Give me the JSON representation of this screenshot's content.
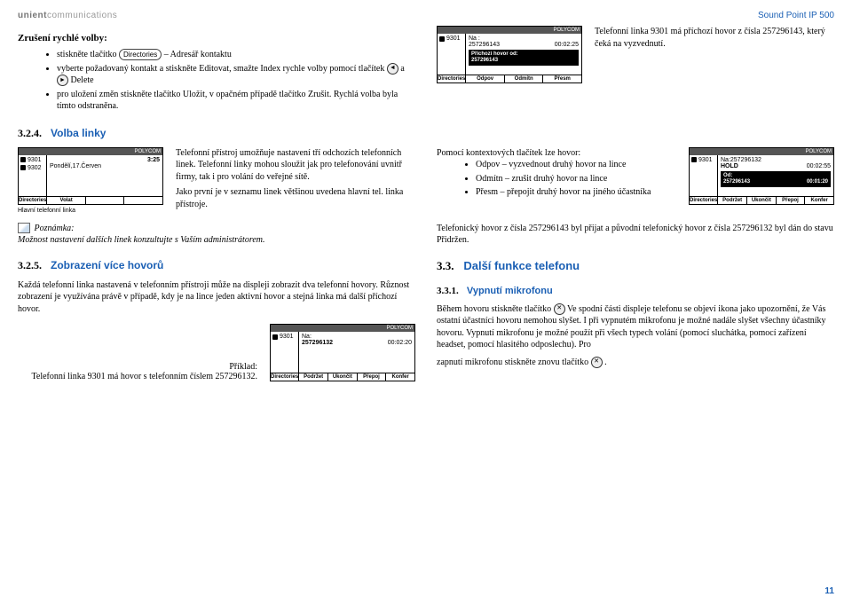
{
  "brand": {
    "part1": "unient",
    "part2": "communications"
  },
  "device_model": "Sound Point IP 500",
  "page_number": "11",
  "top": {
    "heading": "Zrušení rychlé volby:",
    "bullets": {
      "b1a": "stiskněte tlačítko ",
      "dir_btn": "Directories",
      "b1b": " – Adresář kontaktu",
      "b2": "vyberte požadovaný kontakt a stiskněte Editovat, smažte Index rychle volby pomocí tlačítek ",
      "and": " a ",
      "delete": " Delete",
      "b3": "pro uložení změn stiskněte tlačítko Uložit, v opačném případě tlačítko Zrušit. Rychlá volba byla tímto odstraněna."
    },
    "phone1": {
      "brand": "POLYCOM",
      "line": "9301",
      "na": "Na :",
      "num": "257296143",
      "time": "00:02:25",
      "box1": "Příchozí hovor od:",
      "box2": "257296143",
      "s1": "Odpov",
      "s2": "Odmítn",
      "s3": "Přesm",
      "soft_dir": "Directories"
    },
    "right_text": "Telefonní linka 9301 má příchozí hovor z čísla 257296143, který čeká na vyzvednutí."
  },
  "s324": {
    "num": "3.2.4.",
    "title": "Volba linky",
    "phone": {
      "brand": "POLYCOM",
      "l1": "9301",
      "l2": "9302",
      "time": "3:25",
      "date": "Pondělí,17.Červen",
      "s1": "Volat",
      "soft_dir": "Directories"
    },
    "para": "Telefonní přístroj umožňuje nastavení tří odchozích telefonních linek. Telefonní linky mohou sloužit jak pro telefonování uvnitř firmy, tak i pro volání do veřejné sítě.",
    "para2": "Jako první je v seznamu linek většinou uvedena hlavní tel. linka přístroje.",
    "ctx_intro": "Pomocí kontextových tlačítek lze hovor:",
    "ctx": {
      "b1": "Odpov – vyzvednout druhý hovor na lince",
      "b2": "Odmítn – zrušit druhý hovor na lince",
      "b3": "Přesm – přepojit druhý hovor na jiného účastníka"
    },
    "phone_r": {
      "brand": "POLYCOM",
      "line": "9301",
      "na": "Na:257296132",
      "hold": "HOLD",
      "t1": "00:02:55",
      "od": "Od:",
      "num": "257296143",
      "t2": "00:01:20",
      "s1": "Podržet",
      "s2": "Ukončit",
      "s3": "Přepoj",
      "s4": "Konfer",
      "soft_dir": "Directories"
    }
  },
  "note": {
    "label": "Poznámka:",
    "text": "Možnost nastavení dalších linek konzultujte s Vaším administrátorem.",
    "extra_label": "Hlavní telefonní linka"
  },
  "s325": {
    "num": "3.2.5.",
    "title": "Zobrazení více hovorů",
    "para": "Každá telefonní linka nastavená v telefonním přístroji může na displeji zobrazit dva telefonní hovory. Různost zobrazení je využívána právě v případě, kdy je na lince jeden aktivní hovor a stejná linka má další příchozí hovor.",
    "example_label": "Příklad:",
    "example_text": "Telefonní linka 9301 má hovor s telefonním číslem 257296132.",
    "phone": {
      "brand": "POLYCOM",
      "line": "9301",
      "na": "Na:",
      "num": "257296132",
      "time": "00:02:20",
      "s1": "Podržet",
      "s2": "Ukončit",
      "s3": "Přepoj",
      "s4": "Konfer",
      "soft_dir": "Directories"
    }
  },
  "right_col": {
    "p1": "Telefonický hovor z čísla 257296143 byl přijat a původní telefonický hovor z čísla 257296132 byl dán do stavu Přidržen.",
    "s33_num": "3.3.",
    "s33_title": "Další funkce telefonu",
    "s331_num": "3.3.1.",
    "s331_title": "Vypnutí mikrofonu",
    "p2a": "Během hovoru stiskněte tlačítko ",
    "p2b": " Ve spodní části displeje telefonu se objeví ikona jako upozornění, že Vás ostatní účastníci hovoru nemohou slyšet. I při vypnutém mikrofonu je možné nadále slyšet všechny účastníky hovoru. Vypnutí mikrofonu je možné použít při všech typech volání (pomocí sluchátka, pomocí zařízení headset, pomocí hlasitého odposlechu). Pro",
    "p3a": "zapnutí mikrofonu stiskněte znovu tlačítko ",
    "p3b": "."
  }
}
